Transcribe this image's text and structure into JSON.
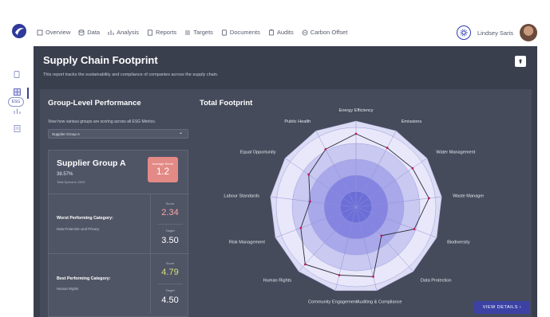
{
  "nav": {
    "items": [
      {
        "label": "Overview",
        "icon": "overview-icon"
      },
      {
        "label": "Data",
        "icon": "data-icon"
      },
      {
        "label": "Analysis",
        "icon": "analysis-icon"
      },
      {
        "label": "Reports",
        "icon": "reports-icon"
      },
      {
        "label": "Targets",
        "icon": "targets-icon"
      },
      {
        "label": "Documents",
        "icon": "documents-icon"
      },
      {
        "label": "Audits",
        "icon": "audits-icon"
      },
      {
        "label": "Carbon Offset",
        "icon": "carbon-offset-icon"
      }
    ],
    "user_name": "Lindsey Saris"
  },
  "sidebar": {
    "badge": "ESG"
  },
  "page": {
    "title": "Supply Chain Footprint",
    "subtitle": "This report tracks the sustainability and compliance of companies across the supply chain."
  },
  "group": {
    "title": "Group-Level Performance",
    "description": "View how various groups are scoring across all ESG Metrics.",
    "selected": "Supplier Group A"
  },
  "card": {
    "name": "Supplier Group A",
    "percent": "38.57%",
    "small_text": "Total Spend in 2023",
    "avg_label": "Average Score",
    "avg_value": "1.2",
    "worst": {
      "title": "Worst Performing Category:",
      "category": "Data Protection and Privacy",
      "score_label": "Score",
      "score": "2.34",
      "target_label": "Target",
      "target": "3.50"
    },
    "best": {
      "title": "Best Performing Category:",
      "category": "Human Rights",
      "score_label": "Score",
      "score": "4.79",
      "target_label": "Target",
      "target": "4.50"
    }
  },
  "footprint": {
    "title": "Total Footprint",
    "button": "VIEW DETAILS  ›"
  },
  "chart_data": {
    "type": "radar",
    "categories": [
      "Energy Efficiency",
      "Emissions",
      "Water Management",
      "Waste Management",
      "Biodiversity",
      "Data Protection",
      "Auditing & Compliance",
      "Community Engagement",
      "Human Rights",
      "Risk Management",
      "Labour Standards",
      "Equal Opportunity",
      "Public Health"
    ],
    "rings": 5,
    "series": [
      {
        "values": [
          4.6,
          4.2,
          4.3,
          4.6,
          3.9,
          2.4,
          4.5,
          4.4,
          4.8,
          3.7,
          2.9,
          3.6,
          4.1
        ]
      }
    ],
    "colors": {
      "web_fill": "#dcdcf5",
      "ring_fills": [
        "#e8e8fa",
        "#c9c9f1",
        "#a8a8ea",
        "#8585e1",
        "#6c6ed8"
      ],
      "line": "#2b2b3a",
      "point": "#c2185b",
      "accent": "#e38a86",
      "score_worst": "#f4a6a6",
      "score_best": "#d8e07a"
    }
  }
}
